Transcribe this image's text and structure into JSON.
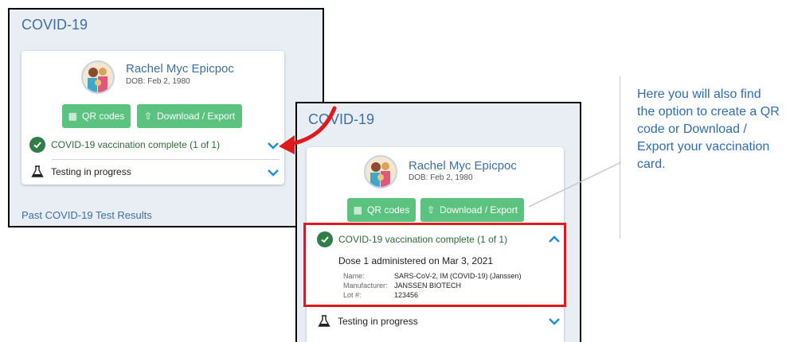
{
  "left": {
    "section_title": "COVID-19",
    "patient": {
      "name": "Rachel Myc Epicpoc",
      "dob": "DOB: Feb 2, 1980"
    },
    "buttons": {
      "qr": "QR codes",
      "download": "Download / Export"
    },
    "vaccination_status": "COVID-19 vaccination complete (1 of 1)",
    "testing_status": "Testing in progress",
    "past_results_link": "Past COVID-19 Test Results"
  },
  "right": {
    "section_title": "COVID-19",
    "patient": {
      "name": "Rachel Myc Epicpoc",
      "dob": "DOB: Feb 2, 1980"
    },
    "buttons": {
      "qr": "QR codes",
      "download": "Download / Export"
    },
    "vaccination_status": "COVID-19 vaccination complete (1 of 1)",
    "dose_line": "Dose 1 administered on Mar 3, 2021",
    "details": [
      {
        "label": "Name:",
        "value": "SARS-CoV-2, IM (COVID-19) (Janssen)"
      },
      {
        "label": "Manufacturer:",
        "value": "JANSSEN BIOTECH"
      },
      {
        "label": "Lot #:",
        "value": "123456"
      }
    ],
    "testing_status": "Testing in progress"
  },
  "callout_text": "Here you will also find the option to create a QR code or Download / Export your vaccination card.",
  "colors": {
    "accent_blue": "#3e6ea3",
    "button_green": "#5cc27f",
    "status_green": "#2f7d47",
    "highlight_red": "#e0191c",
    "callout_blue": "#2e6db5"
  }
}
